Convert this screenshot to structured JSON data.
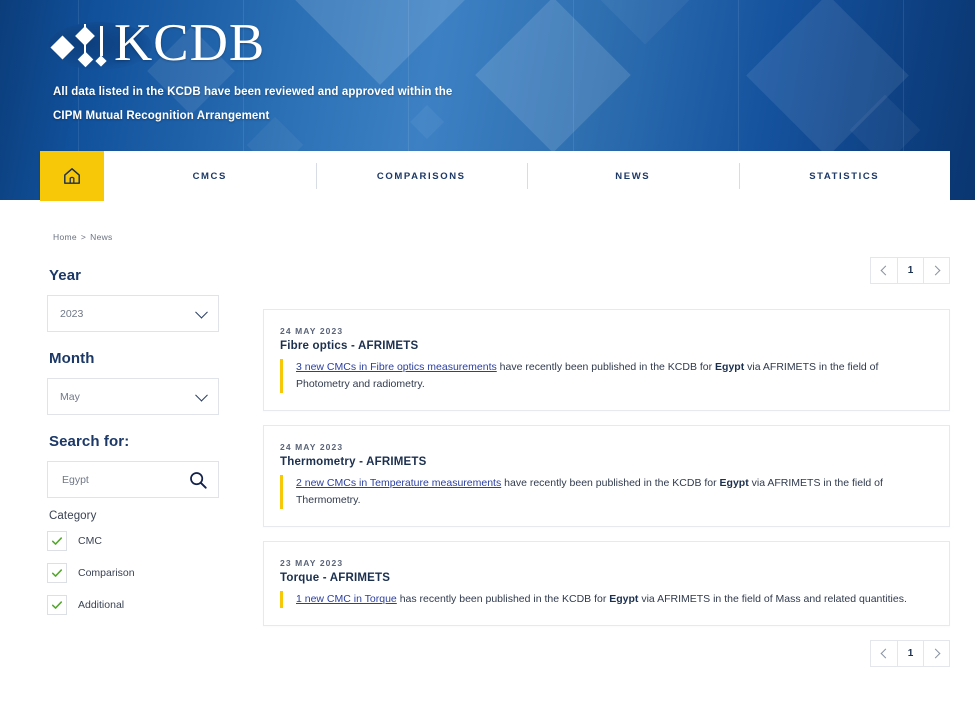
{
  "banner": {
    "logo_text": "KCDB",
    "subtitle_line1": "All data listed in the KCDB have been reviewed and approved within the",
    "subtitle_line2": "CIPM Mutual Recognition Arrangement",
    "accent_yellow": "#F7C808",
    "brand_blue": "#11519C"
  },
  "nav": {
    "home_icon": "home-icon",
    "items": [
      {
        "label": "CMCS"
      },
      {
        "label": "COMPARISONS"
      },
      {
        "label": "NEWS"
      },
      {
        "label": "STATISTICS"
      }
    ]
  },
  "breadcrumb": {
    "home": "Home",
    "separator": ">",
    "current": "News"
  },
  "sidebar": {
    "year": {
      "label": "Year",
      "value": "2023"
    },
    "month": {
      "label": "Month",
      "value": "May"
    },
    "search": {
      "label": "Search for:",
      "value": "Egypt",
      "placeholder": "Search",
      "icon": "search-icon"
    },
    "category": {
      "label": "Category",
      "options": [
        {
          "label": "CMC",
          "checked": true
        },
        {
          "label": "Comparison",
          "checked": true
        },
        {
          "label": "Additional",
          "checked": true
        }
      ]
    }
  },
  "pagination": {
    "prev": "prev-page-icon",
    "page": "1",
    "next": "next-page-icon"
  },
  "news": {
    "cards": [
      {
        "date": "24  MAY 2023",
        "title": "Fibre optics - AFRIMETS",
        "link": "3 new CMCs in Fibre optics measurements",
        "text_mid": " have recently been published in the KCDB for ",
        "bold": "Egypt",
        "text_end": " via AFRIMETS in the field of Photometry and radiometry."
      },
      {
        "date": "24  MAY 2023",
        "title": "Thermometry - AFRIMETS",
        "link": "2 new CMCs in Temperature measurements",
        "text_mid": " have recently been published in the KCDB for ",
        "bold": "Egypt",
        "text_end": " via AFRIMETS in the field of Thermometry."
      },
      {
        "date": "23  MAY 2023",
        "title": "Torque - AFRIMETS",
        "link": "1 new CMC in Torque",
        "text_mid": " has recently been published in the KCDB for ",
        "bold": "Egypt",
        "text_end": " via AFRIMETS in the field of Mass and related quantities."
      }
    ]
  }
}
